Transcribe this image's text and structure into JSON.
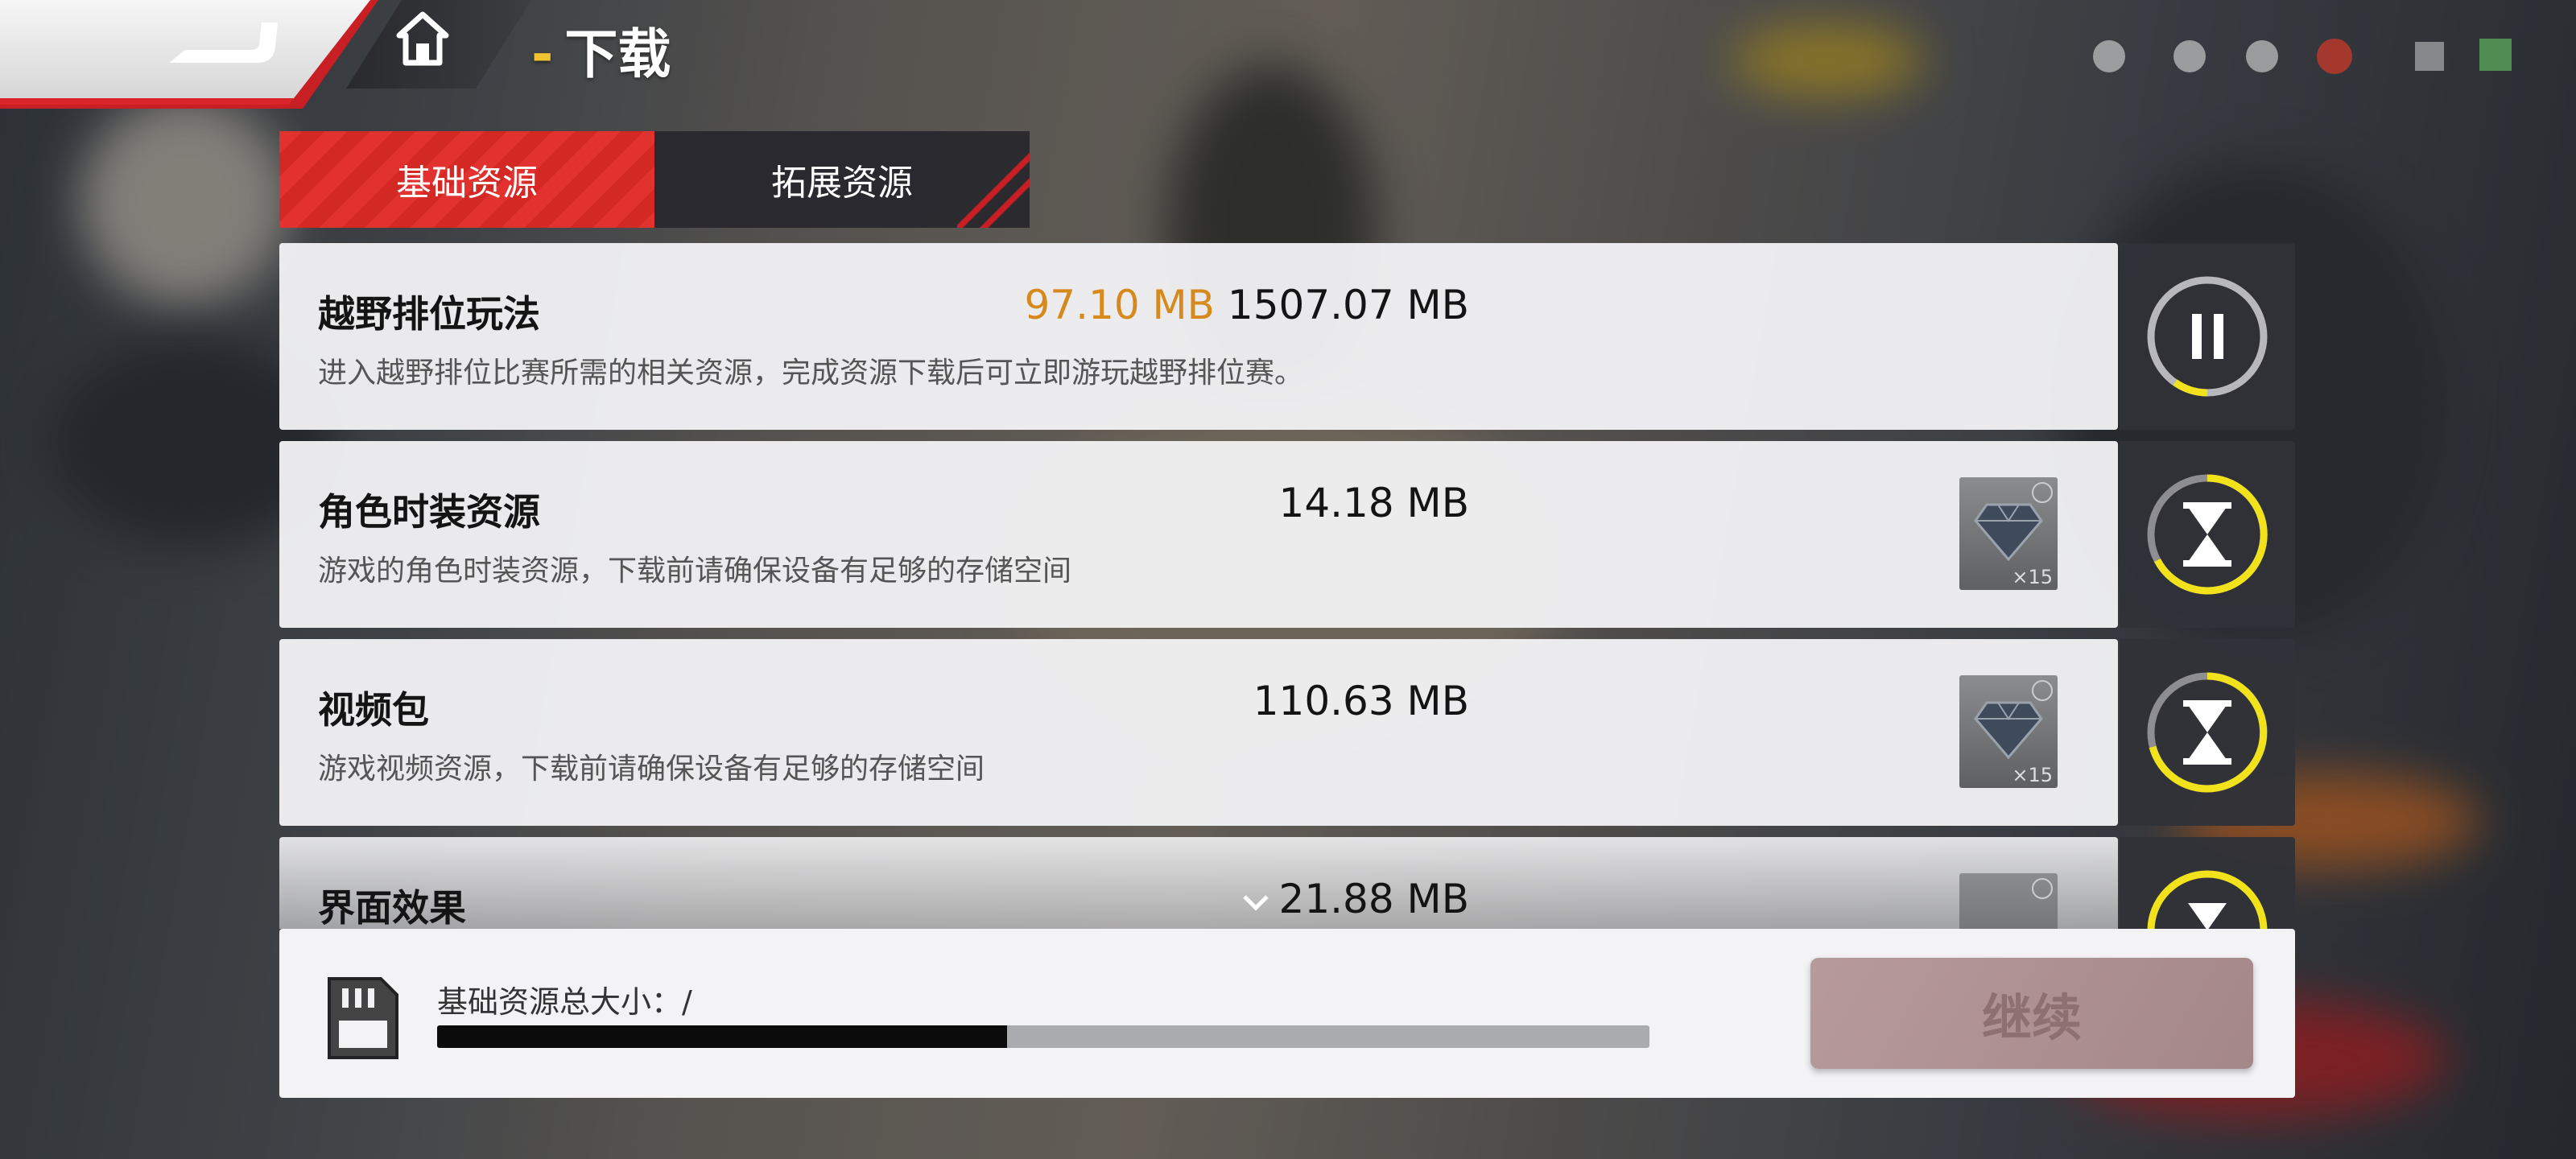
{
  "header": {
    "title_dash": "-",
    "title": "下载"
  },
  "tabs": [
    {
      "label": "基础资源",
      "active": true
    },
    {
      "label": "拓展资源",
      "active": false
    }
  ],
  "items": [
    {
      "name": "越野排位玩法",
      "description": "进入越野排位比赛所需的相关资源，完成资源下载后可立即游玩越野排位赛。",
      "downloaded": "97.10 MB",
      "size": "1507.07 MB",
      "state": "downloading",
      "progress": 0.1,
      "action_icon": "pause-icon"
    },
    {
      "name": "角色时装资源",
      "description": "游戏的角色时装资源，下载前请确保设备有足够的存储空间",
      "size": "14.18 MB",
      "reward_qty": "×15",
      "reward_icon": "diamond-icon",
      "state": "queued",
      "progress": 0.8,
      "action_icon": "hourglass-icon"
    },
    {
      "name": "视频包",
      "description": "游戏视频资源，下载前请确保设备有足够的存储空间",
      "size": "110.63 MB",
      "reward_qty": "×15",
      "reward_icon": "diamond-icon",
      "state": "queued",
      "progress": 0.6,
      "action_icon": "hourglass-icon"
    },
    {
      "name": "界面效果",
      "size": "21.88 MB",
      "state": "queued",
      "action_icon": "hourglass-icon",
      "expand_icon": "chevron-down-icon"
    }
  ],
  "footer": {
    "total_label": "基础资源总大小：/",
    "progress": 0.47,
    "continue_label": "继续"
  },
  "colors": {
    "accent_red": "#d42825",
    "downloaded_orange": "#d68a1e",
    "ring_yellow": "#f1e21c"
  }
}
